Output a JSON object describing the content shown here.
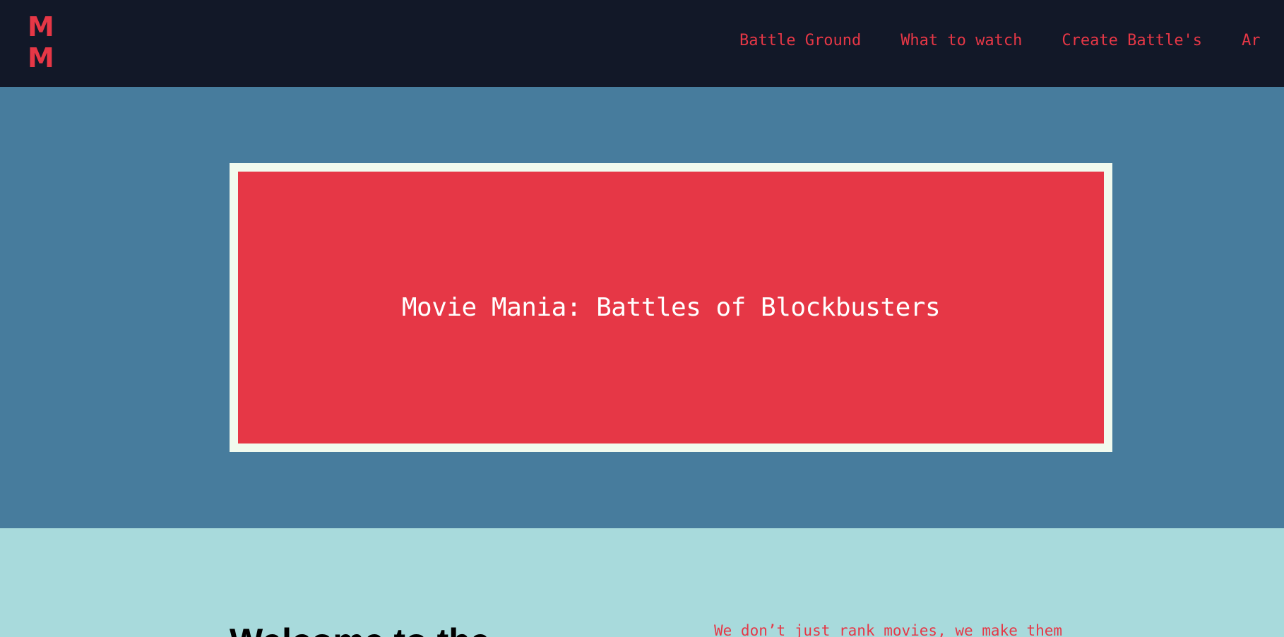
{
  "header": {
    "logo_line1": "M",
    "logo_line2": "M",
    "nav": [
      {
        "label": "Battle Ground"
      },
      {
        "label": "What to watch"
      },
      {
        "label": "Create Battle's"
      },
      {
        "label": "Ar"
      }
    ]
  },
  "hero": {
    "title": "Movie Mania: Battles of Blockbusters"
  },
  "intro": {
    "heading": "Welcome to the",
    "text": "We don’t just rank movies, we make them"
  },
  "colors": {
    "nav_bg": "#121828",
    "accent_red": "#e63746",
    "hero_bg": "#477c9d",
    "frame": "#f1faee",
    "intro_bg": "#a8dadc"
  }
}
